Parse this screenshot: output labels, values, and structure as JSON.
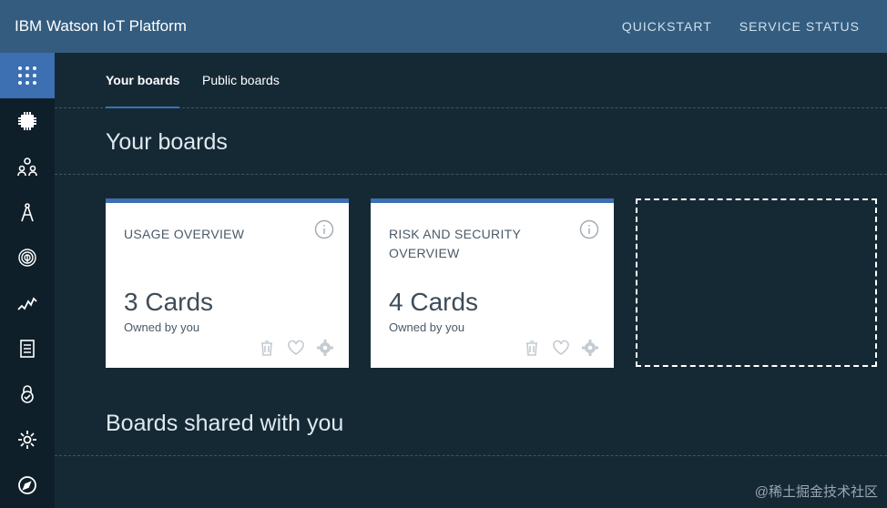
{
  "header": {
    "brand": "IBM Watson IoT Platform",
    "nav": [
      "QUICKSTART",
      "SERVICE STATUS"
    ],
    "bg_color": "#335c7f"
  },
  "sidebar": {
    "items": [
      {
        "name": "boards",
        "icon": "grid-dots-icon",
        "active": true
      },
      {
        "name": "devices",
        "icon": "chip-icon"
      },
      {
        "name": "members",
        "icon": "users-icon"
      },
      {
        "name": "apps",
        "icon": "compass-draw-icon"
      },
      {
        "name": "security",
        "icon": "fingerprint-icon"
      },
      {
        "name": "rules",
        "icon": "activity-icon"
      },
      {
        "name": "reports",
        "icon": "document-icon"
      },
      {
        "name": "risk",
        "icon": "lock-check-icon"
      },
      {
        "name": "settings",
        "icon": "gear-icon"
      },
      {
        "name": "explore",
        "icon": "compass-icon"
      }
    ],
    "accent_color": "#3d70b2"
  },
  "tabs": [
    {
      "label": "Your boards",
      "active": true
    },
    {
      "label": "Public boards",
      "active": false
    }
  ],
  "sections": {
    "your_boards": "Your boards",
    "shared": "Boards shared with you"
  },
  "cards": [
    {
      "title": "USAGE OVERVIEW",
      "count": "3 Cards",
      "owner": "Owned by you"
    },
    {
      "title": "RISK AND SECURITY OVERVIEW",
      "count": "4 Cards",
      "owner": "Owned by you"
    }
  ],
  "watermark": "@稀土掘金技术社区"
}
